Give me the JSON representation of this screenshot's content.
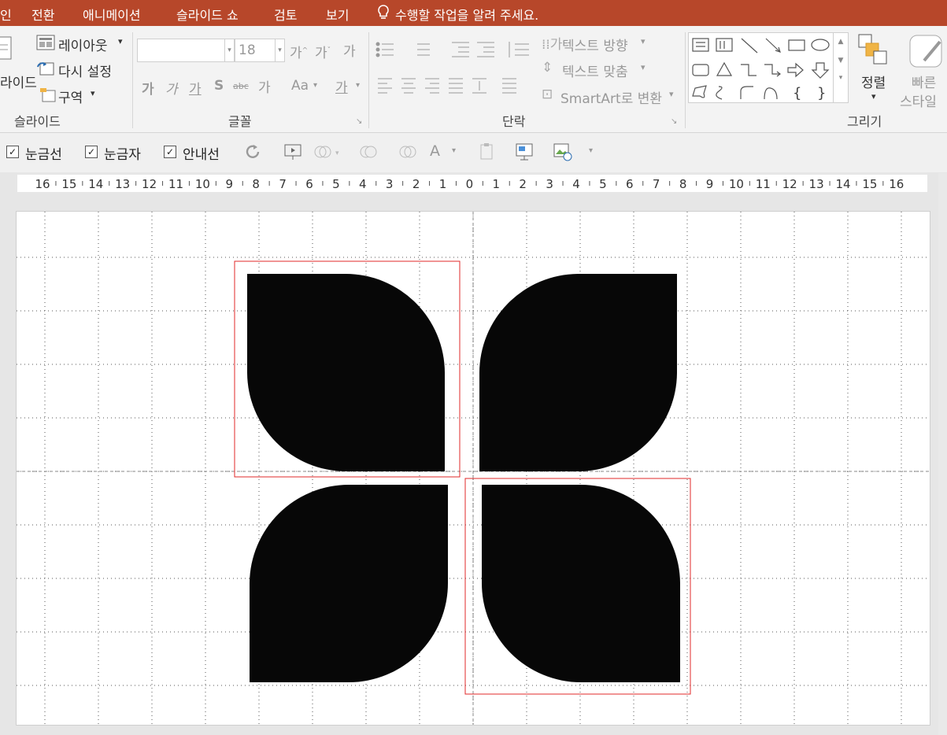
{
  "menu": {
    "items": [
      "인",
      "전환",
      "애니메이션",
      "슬라이드 쇼",
      "검토",
      "보기"
    ],
    "tell_me": "수행할 작업을 알려 주세요."
  },
  "ribbon": {
    "slide_group": {
      "label": "슬라이드",
      "new_slide_partial": "라이드",
      "layout": "레이아웃",
      "reset": "다시 설정",
      "section": "구역"
    },
    "font_group": {
      "label": "글꼴",
      "font_size": "18"
    },
    "paragraph_group": {
      "label": "단락",
      "text_direction": "텍스트 방향",
      "align_text": "텍스트 맞춤",
      "smartart": "SmartArt로 변환"
    },
    "drawing_group": {
      "label": "그리기",
      "arrange": "정렬",
      "quick_styles_1": "빠른",
      "quick_styles_2": "스타일"
    }
  },
  "options": {
    "gridlines": "눈금선",
    "ruler": "눈금자",
    "guides": "안내선"
  },
  "ruler": {
    "labels": [
      "16",
      "15",
      "14",
      "13",
      "12",
      "11",
      "10",
      "9",
      "8",
      "7",
      "6",
      "5",
      "4",
      "3",
      "2",
      "1",
      "0",
      "1",
      "2",
      "3",
      "4",
      "5",
      "6",
      "7",
      "8",
      "9",
      "10",
      "11",
      "12",
      "13",
      "14",
      "15",
      "16"
    ]
  },
  "colors": {
    "menu_bg": "#b7472a",
    "selection": "#e0282a",
    "shape_fill": "#070707"
  }
}
